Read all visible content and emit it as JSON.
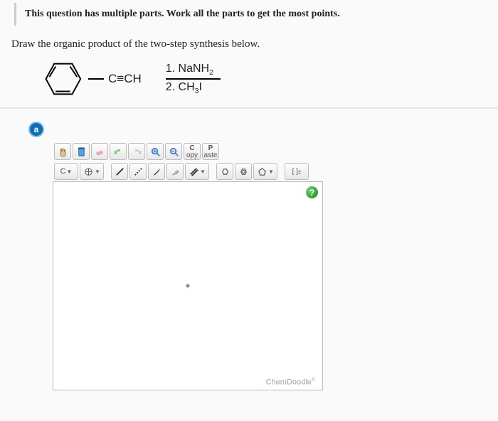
{
  "header": {
    "banner": "This question has multiple parts. Work all the parts to get the most points."
  },
  "question": {
    "prompt": "Draw the organic product of the two-step synthesis below."
  },
  "reaction": {
    "substituent": "C≡CH",
    "step1_label": "1. NaNH",
    "step1_sub": "2",
    "step2_label": "2. CH",
    "step2_sub": "3",
    "step2_tail": "I"
  },
  "part": {
    "label": "a"
  },
  "toolbar1": {
    "copy_top": "C",
    "copy_bot": "opy",
    "paste_top": "P",
    "paste_bot": "aste"
  },
  "toolbar2": {
    "element": "C",
    "bracket": "[ ]",
    "charge": "±"
  },
  "canvas": {
    "help": "?",
    "brand": "ChemDoodle",
    "brand_mark": "®"
  }
}
